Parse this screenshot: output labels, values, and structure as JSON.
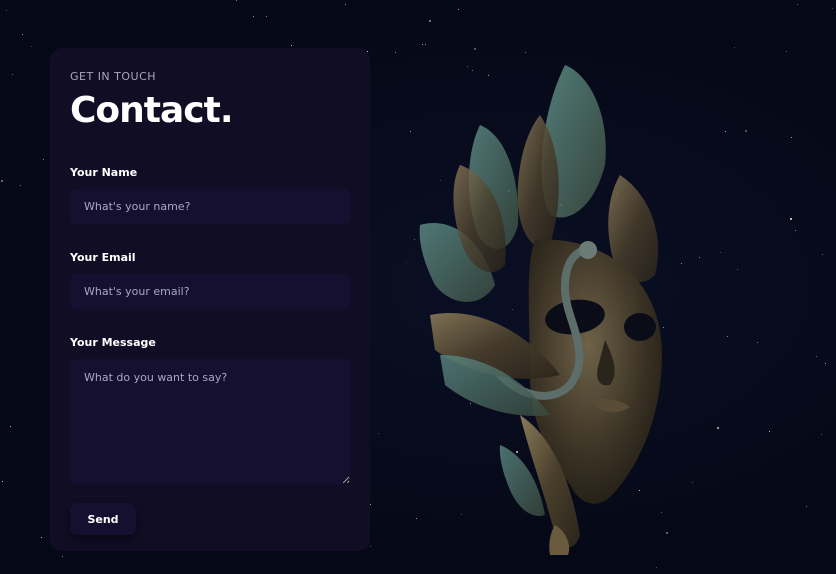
{
  "contact": {
    "eyebrow": "GET IN TOUCH",
    "title": "Contact."
  },
  "form": {
    "name": {
      "label": "Your Name",
      "placeholder": "What's your name?"
    },
    "email": {
      "label": "Your Email",
      "placeholder": "What's your email?"
    },
    "message": {
      "label": "Your Message",
      "placeholder": "What do you want to say?"
    },
    "submit_label": "Send"
  },
  "theme": {
    "background": "#050816",
    "card": "#100d25",
    "input": "#151030",
    "secondary_text": "#aaa6c3",
    "primary_text": "#ffffff"
  },
  "visual": {
    "icon": "venetian-mask-illustration"
  }
}
